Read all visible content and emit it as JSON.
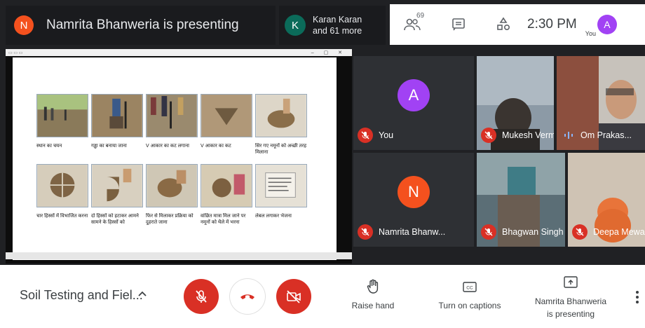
{
  "header": {
    "presenter": {
      "initial": "N",
      "text": "Namrita Bhanweria is presenting",
      "avatar_color": "#f4511e"
    },
    "participants": {
      "initial": "K",
      "line1": "Karan Karan",
      "line2": "and 61 more",
      "avatar_color": "#0b6b5a"
    },
    "people_count": "69",
    "time": "2:30 PM",
    "self_label": "You",
    "self_initial": "A",
    "self_color": "#a142f4"
  },
  "presentation": {
    "row1": [
      {
        "caption": "स्थान का चयन"
      },
      {
        "caption": "गड्ढा का बनाया जाना"
      },
      {
        "caption": "V आकार का कट लगाना"
      },
      {
        "caption": "V आकार का कट"
      },
      {
        "caption": "सिर गए नमूनों को अच्छी तरह मिलाना"
      }
    ],
    "row2": [
      {
        "caption": "चार हिस्सों में विभाजित करना"
      },
      {
        "caption": "दो हिस्सों को हटाकर आमने सामने के हिस्सों को"
      },
      {
        "caption": "फिर से मिलाकर प्रक्रिया को दुहराते जाना"
      },
      {
        "caption": "वांछित मात्रा मिल जाने पर नमूनों को थैले में भरना"
      },
      {
        "caption": "लेबल लगाकर भेजना"
      }
    ]
  },
  "tiles": [
    {
      "name": "You",
      "initial": "A",
      "avatar_color": "#a142f4",
      "muted": true
    },
    {
      "name": "Mukesh Verma",
      "muted": true
    },
    {
      "name": "Om Prakas...",
      "muted": false
    },
    {
      "name": "Namrita Bhanw...",
      "initial": "N",
      "avatar_color": "#f4511e",
      "muted": true
    },
    {
      "name": "Bhagwan Singh",
      "muted": true
    },
    {
      "name": "Deepa Mewada",
      "muted": true
    }
  ],
  "bottom": {
    "meeting_title": "Soil Testing and Fiel...",
    "raise_hand": "Raise hand",
    "captions": "Turn on captions",
    "presenting_line1": "Namrita Bhanweria",
    "presenting_line2": "is presenting",
    "accent_red": "#d93025"
  }
}
